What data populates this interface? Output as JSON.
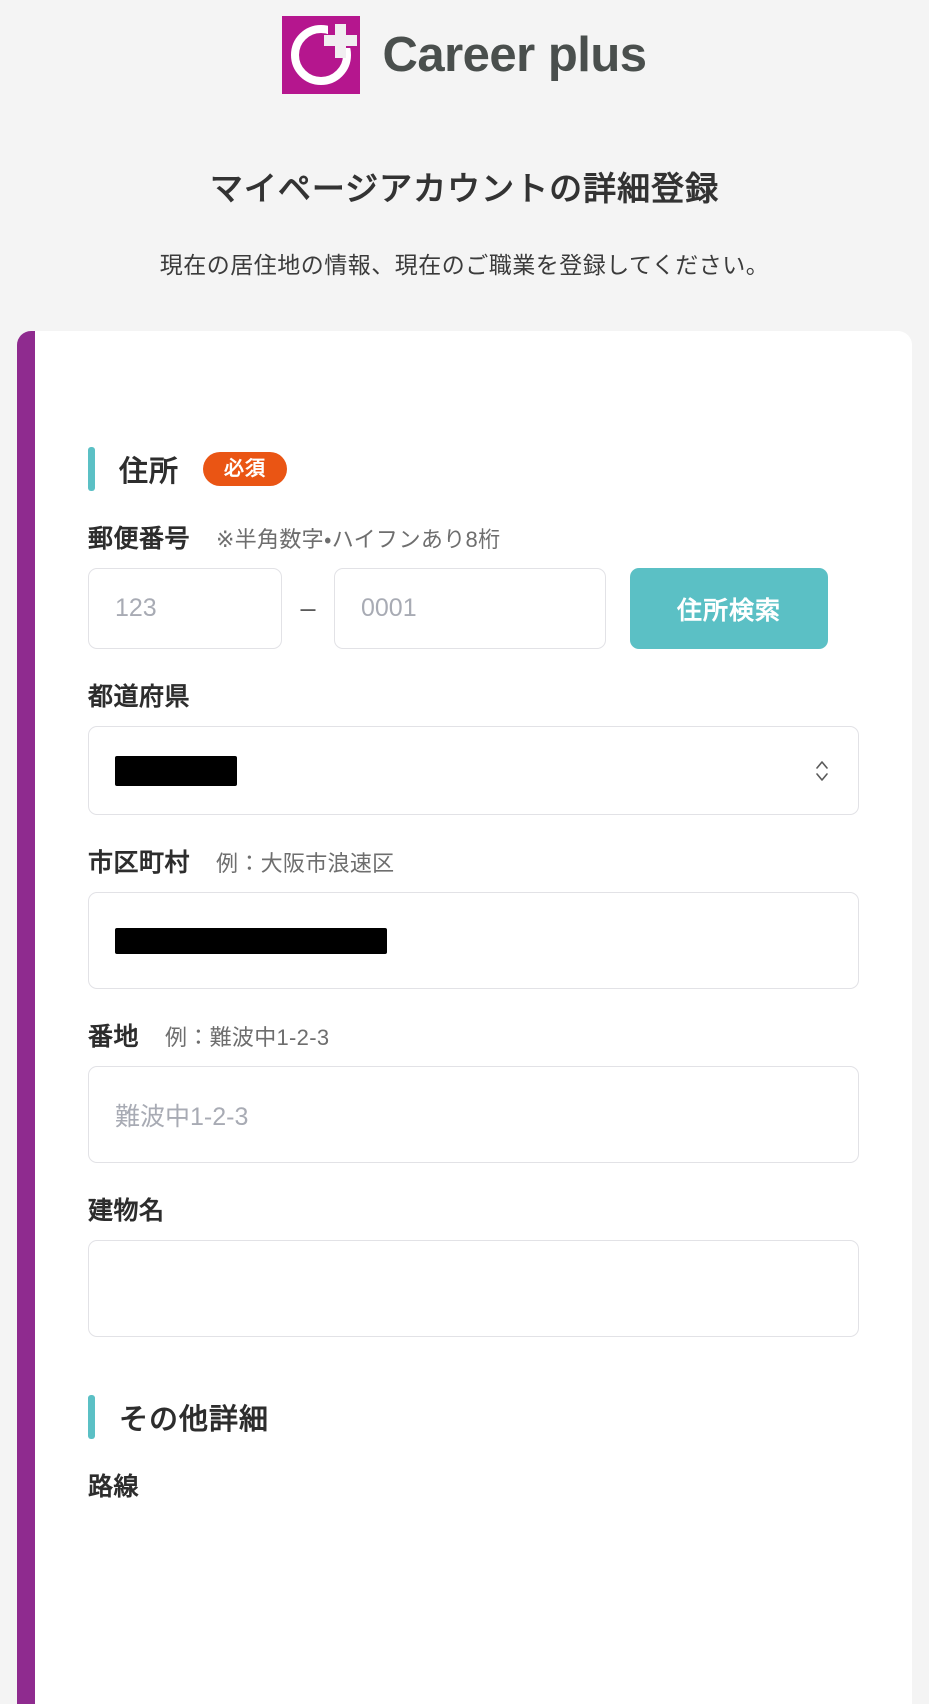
{
  "brand": {
    "name": "Career plus",
    "logo_colors": {
      "mark_bg": "#b5168e",
      "glyph": "#ffffff"
    }
  },
  "header": {
    "title": "マイページアカウントの詳細登録",
    "subtitle": "現在の居住地の情報、現在のご職業を登録してください。"
  },
  "theme": {
    "accent_bar": "#5bc0c5",
    "required_badge_bg": "#ea5514",
    "card_left_border": "#8f2b8f",
    "button_primary": "#5bc0c5",
    "page_bg": "#f4f4f4"
  },
  "sections": [
    {
      "title": "住所",
      "badge": "必須"
    },
    {
      "title": "その他詳細",
      "badge": ""
    }
  ],
  "fields": {
    "postal": {
      "label": "郵便番号",
      "hint": "※半角数字・ハイフンあり8桁",
      "first_placeholder": "123",
      "second_placeholder": "0001",
      "separator": "–",
      "search_button": "住所検索"
    },
    "prefecture": {
      "label": "都道府県",
      "hint": "",
      "value": "",
      "redacted": true,
      "chevron_up": "︿",
      "chevron_down": "﹀"
    },
    "city": {
      "label": "市区町村",
      "hint": "例：大阪市浪速区",
      "value": "",
      "redacted": true
    },
    "street": {
      "label": "番地",
      "hint": "例：難波中1-2-3",
      "placeholder": "難波中1-2-3"
    },
    "building": {
      "label": "建物名",
      "hint": "",
      "placeholder": ""
    },
    "route": {
      "label": "路線"
    }
  }
}
